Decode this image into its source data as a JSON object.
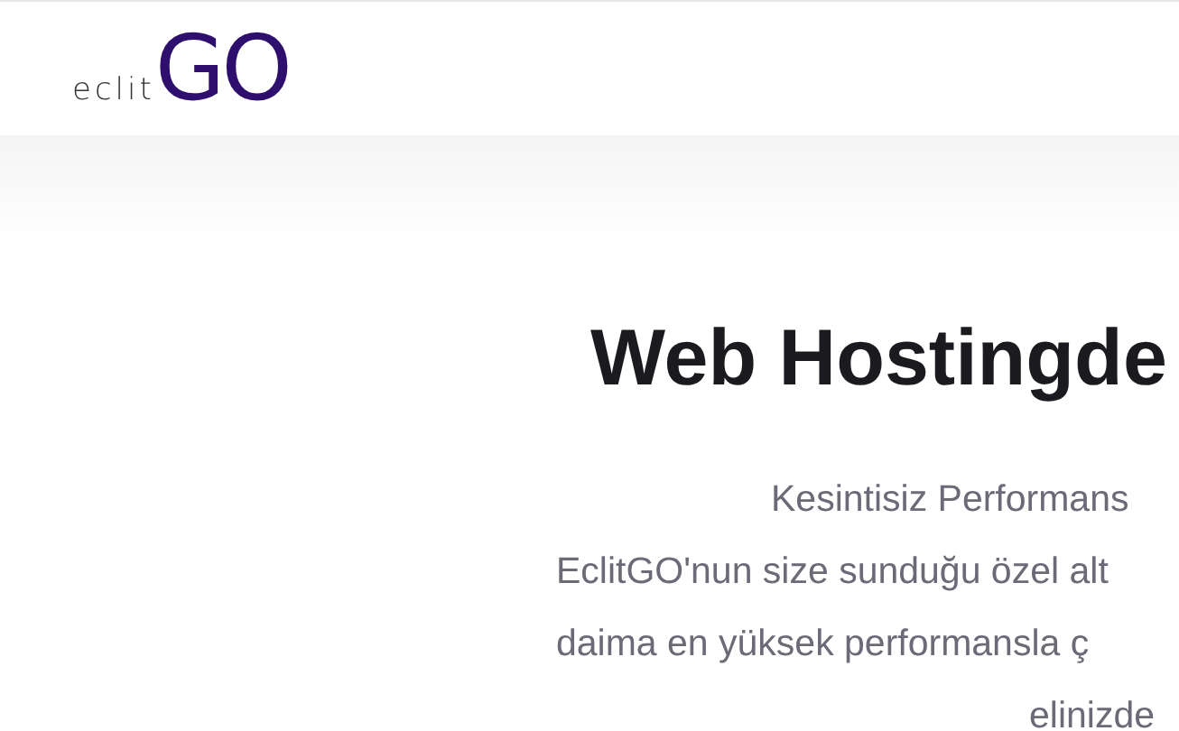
{
  "header": {
    "logo": {
      "prefix": "eclit",
      "brand": "GO"
    }
  },
  "hero": {
    "title": "Web Hostingde",
    "lines": [
      "Kesintisiz Performans",
      "EclitGO'nun size sunduğu özel alt",
      "daima en yüksek performansla ç",
      "elinizde"
    ]
  }
}
